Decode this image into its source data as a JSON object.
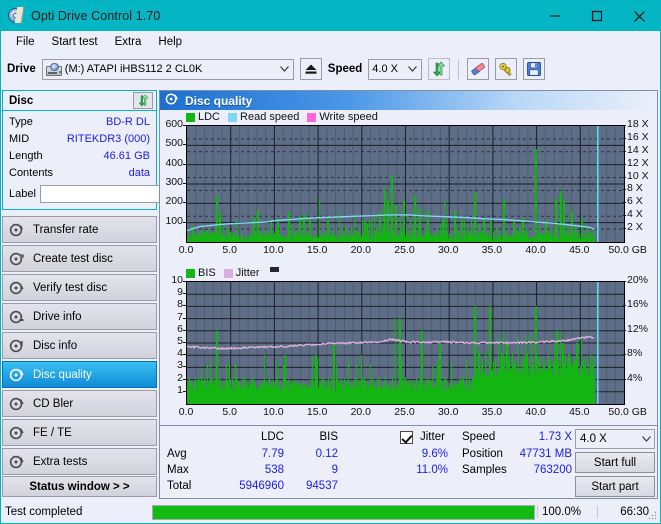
{
  "window": {
    "title": "Opti Drive Control 1.70",
    "icon": "disc-icon",
    "minimize": "–",
    "maximize": "□",
    "close": "✕"
  },
  "menu": {
    "items": [
      {
        "label": "File",
        "name": "menu-file"
      },
      {
        "label": "Start test",
        "name": "menu-start-test"
      },
      {
        "label": "Extra",
        "name": "menu-extra"
      },
      {
        "label": "Help",
        "name": "menu-help"
      }
    ]
  },
  "toolbar": {
    "drive_label": "Drive",
    "drive_value": "(M:)   ATAPI iHBS112  2 CL0K",
    "eject_icon": "eject-icon",
    "speed_label": "Speed",
    "speed_value": "4.0 X",
    "refresh_icon": "refresh-icon",
    "erase_icon": "eraser-icon",
    "key_icon": "keys-icon",
    "save_icon": "floppy-save-icon"
  },
  "disc_panel": {
    "title": "Disc",
    "refresh_icon": "refresh-icon",
    "rows": [
      {
        "key": "Type",
        "value": "BD-R DL"
      },
      {
        "key": "MID",
        "value": "RITEKDR3 (000)"
      },
      {
        "key": "Length",
        "value": "46.61 GB"
      },
      {
        "key": "Contents",
        "value": "data"
      }
    ],
    "label_key": "Label",
    "label_value": "",
    "label_placeholder": "",
    "disc_icon": "cd-disc-icon"
  },
  "sidebar": {
    "items": [
      {
        "label": "Transfer rate",
        "icon": "disc-rate-icon",
        "active": false
      },
      {
        "label": "Create test disc",
        "icon": "disc-create-icon",
        "active": false
      },
      {
        "label": "Verify test disc",
        "icon": "disc-verify-icon",
        "active": false
      },
      {
        "label": "Drive info",
        "icon": "disc-drive-icon",
        "active": false
      },
      {
        "label": "Disc info",
        "icon": "disc-info-icon",
        "active": false
      },
      {
        "label": "Disc quality",
        "icon": "disc-quality-icon",
        "active": true
      },
      {
        "label": "CD Bler",
        "icon": "disc-bler-icon",
        "active": false
      },
      {
        "label": "FE / TE",
        "icon": "disc-fete-icon",
        "active": false
      },
      {
        "label": "Extra tests",
        "icon": "disc-extra-icon",
        "active": false
      }
    ],
    "status_window": "Status window > >"
  },
  "main": {
    "header_title": "Disc quality",
    "header_icon": "disc-quality-icon"
  },
  "stats": {
    "col_ldc": "LDC",
    "col_bis": "BIS",
    "jitter_label": "Jitter",
    "jitter_checked": true,
    "row_avg": "Avg",
    "row_max": "Max",
    "row_total": "Total",
    "ldc_avg": "7.79",
    "ldc_max": "538",
    "ldc_total": "5946960",
    "bis_avg": "0.12",
    "bis_max": "9",
    "bis_total": "94537",
    "jitter_avg": "9.6%",
    "jitter_max": "11.0%",
    "speed_label": "Speed",
    "speed_value": "1.73 X",
    "position_label": "Position",
    "position_value": "47731 MB",
    "samples_label": "Samples",
    "samples_value": "763200",
    "speed_select": "4.0 X",
    "start_full": "Start full",
    "start_part": "Start part"
  },
  "statusbar": {
    "text": "Test completed",
    "percent": "100.0%",
    "progress": 100,
    "time": "66:30"
  },
  "chart_data": [
    {
      "type": "line",
      "title": "Disc quality - LDC / Read speed",
      "xlabel": "GB",
      "ylabel": "LDC",
      "y2label": "X",
      "xlim": [
        0,
        50
      ],
      "ylim": [
        0,
        600
      ],
      "y2lim": [
        0,
        18
      ],
      "grid": true,
      "legend_position": "top-left",
      "legend": [
        {
          "name": "LDC",
          "color": "#13b513"
        },
        {
          "name": "Read speed",
          "color": "#7fd5f2"
        },
        {
          "name": "Write speed",
          "color": "#ff66d9"
        }
      ],
      "xticks": [
        "0.0",
        "5.0",
        "10.0",
        "15.0",
        "20.0",
        "25.0",
        "30.0",
        "35.0",
        "40.0",
        "45.0",
        "50.0 GB"
      ],
      "yticks": [
        "100",
        "200",
        "300",
        "400",
        "500",
        "600"
      ],
      "y2ticks": [
        "2 X",
        "4 X",
        "6 X",
        "8 X",
        "10 X",
        "12 X",
        "14 X",
        "16 X",
        "18 X"
      ],
      "data_end_gb": 46.6,
      "cursor_gb": 47.0,
      "series": [
        {
          "name": "Read speed",
          "color": "#7fd5f2",
          "x": [
            0.0,
            1.5,
            3.0,
            4.5,
            6.0,
            7.5,
            9.0,
            10.0,
            12.0,
            14.0,
            15.5,
            17.5,
            19.5,
            21.5,
            23.0,
            24.5,
            25.5,
            26.5,
            28.0,
            30.0,
            32.0,
            34.0,
            36.0,
            38.0,
            40.0,
            42.0,
            44.0,
            46.0,
            46.6
          ],
          "values": [
            1.8,
            2.4,
            2.6,
            2.8,
            2.9,
            3.0,
            3.1,
            3.3,
            3.5,
            3.7,
            3.8,
            3.9,
            4.0,
            4.1,
            4.2,
            4.2,
            4.2,
            4.1,
            4.0,
            3.9,
            3.8,
            3.6,
            3.5,
            3.3,
            3.1,
            2.9,
            2.6,
            2.3,
            2.0
          ]
        },
        {
          "name": "LDC",
          "color": "#13b513",
          "note": "dense spike histogram, baseline ~10-40, peaks up to 538",
          "baseline": 25,
          "peaks": [
            {
              "x": 3.4,
              "y": 245
            },
            {
              "x": 3.7,
              "y": 150
            },
            {
              "x": 5.6,
              "y": 115
            },
            {
              "x": 7.6,
              "y": 130
            },
            {
              "x": 8.1,
              "y": 165
            },
            {
              "x": 9.6,
              "y": 120
            },
            {
              "x": 10.4,
              "y": 120
            },
            {
              "x": 11.6,
              "y": 155
            },
            {
              "x": 12.9,
              "y": 130
            },
            {
              "x": 13.3,
              "y": 145
            },
            {
              "x": 14.0,
              "y": 120
            },
            {
              "x": 15.1,
              "y": 225
            },
            {
              "x": 16.1,
              "y": 120
            },
            {
              "x": 17.4,
              "y": 155
            },
            {
              "x": 19.1,
              "y": 140
            },
            {
              "x": 20.3,
              "y": 105
            },
            {
              "x": 21.4,
              "y": 135
            },
            {
              "x": 22.0,
              "y": 160
            },
            {
              "x": 22.6,
              "y": 270
            },
            {
              "x": 22.9,
              "y": 215
            },
            {
              "x": 23.4,
              "y": 345
            },
            {
              "x": 23.9,
              "y": 190
            },
            {
              "x": 24.8,
              "y": 215
            },
            {
              "x": 26.0,
              "y": 240
            },
            {
              "x": 26.6,
              "y": 180
            },
            {
              "x": 27.5,
              "y": 165
            },
            {
              "x": 29.4,
              "y": 215
            },
            {
              "x": 30.6,
              "y": 165
            },
            {
              "x": 31.4,
              "y": 120
            },
            {
              "x": 32.9,
              "y": 255
            },
            {
              "x": 33.9,
              "y": 115
            },
            {
              "x": 34.7,
              "y": 110
            },
            {
              "x": 36.2,
              "y": 220
            },
            {
              "x": 37.4,
              "y": 115
            },
            {
              "x": 38.4,
              "y": 125
            },
            {
              "x": 39.9,
              "y": 480
            },
            {
              "x": 41.0,
              "y": 110
            },
            {
              "x": 42.2,
              "y": 230
            },
            {
              "x": 42.7,
              "y": 265
            },
            {
              "x": 43.1,
              "y": 215
            },
            {
              "x": 44.0,
              "y": 160
            },
            {
              "x": 45.1,
              "y": 120
            }
          ]
        }
      ]
    },
    {
      "type": "line",
      "title": "Disc quality - BIS / Jitter",
      "xlabel": "GB",
      "ylabel": "BIS",
      "y2label": "%",
      "xlim": [
        0,
        50
      ],
      "ylim": [
        0,
        10
      ],
      "y2lim": [
        0,
        20
      ],
      "grid": true,
      "legend_position": "top-left",
      "legend": [
        {
          "name": "BIS",
          "color": "#13b513"
        },
        {
          "name": "Jitter",
          "color": "#dbb0de"
        }
      ],
      "xticks": [
        "0.0",
        "5.0",
        "10.0",
        "15.0",
        "20.0",
        "25.0",
        "30.0",
        "35.0",
        "40.0",
        "45.0",
        "50.0 GB"
      ],
      "yticks": [
        "1",
        "2",
        "3",
        "4",
        "5",
        "6",
        "7",
        "8",
        "9",
        "10"
      ],
      "y2ticks": [
        "4%",
        "8%",
        "12%",
        "16%",
        "20%"
      ],
      "data_end_gb": 46.6,
      "cursor_gb": 47.0,
      "series": [
        {
          "name": "Jitter",
          "color": "#dbb0de",
          "x": [
            0.0,
            2.0,
            4.0,
            6.0,
            8.0,
            10.0,
            12.0,
            14.0,
            16.0,
            18.0,
            20.0,
            22.0,
            23.5,
            25.0,
            27.0,
            29.0,
            31.0,
            33.0,
            35.0,
            37.0,
            39.0,
            41.0,
            43.0,
            45.0,
            46.0,
            46.6
          ],
          "values": [
            9.4,
            9.2,
            9.1,
            9.2,
            9.3,
            9.4,
            9.5,
            9.7,
            9.9,
            10.0,
            10.1,
            10.2,
            10.6,
            10.2,
            10.1,
            10.2,
            10.1,
            10.0,
            10.1,
            10.0,
            10.1,
            10.2,
            10.3,
            10.8,
            11.0,
            10.9
          ]
        },
        {
          "name": "BIS",
          "color": "#13b513",
          "note": "dense spike histogram, baseline ~2, rising to ~4 after 33 GB; peaks up to 9",
          "baseline": 2,
          "peaks": [
            {
              "x": 3.4,
              "y": 6
            },
            {
              "x": 8.8,
              "y": 4
            },
            {
              "x": 11.2,
              "y": 4
            },
            {
              "x": 14.7,
              "y": 4
            },
            {
              "x": 16.8,
              "y": 5
            },
            {
              "x": 19.9,
              "y": 4
            },
            {
              "x": 23.8,
              "y": 7
            },
            {
              "x": 24.3,
              "y": 7
            },
            {
              "x": 26.8,
              "y": 6
            },
            {
              "x": 28.9,
              "y": 5
            },
            {
              "x": 32.9,
              "y": 8
            },
            {
              "x": 34.6,
              "y": 8
            },
            {
              "x": 36.6,
              "y": 5
            },
            {
              "x": 39.9,
              "y": 8
            },
            {
              "x": 42.3,
              "y": 6
            },
            {
              "x": 43.0,
              "y": 5
            },
            {
              "x": 44.6,
              "y": 5
            }
          ]
        }
      ]
    }
  ]
}
